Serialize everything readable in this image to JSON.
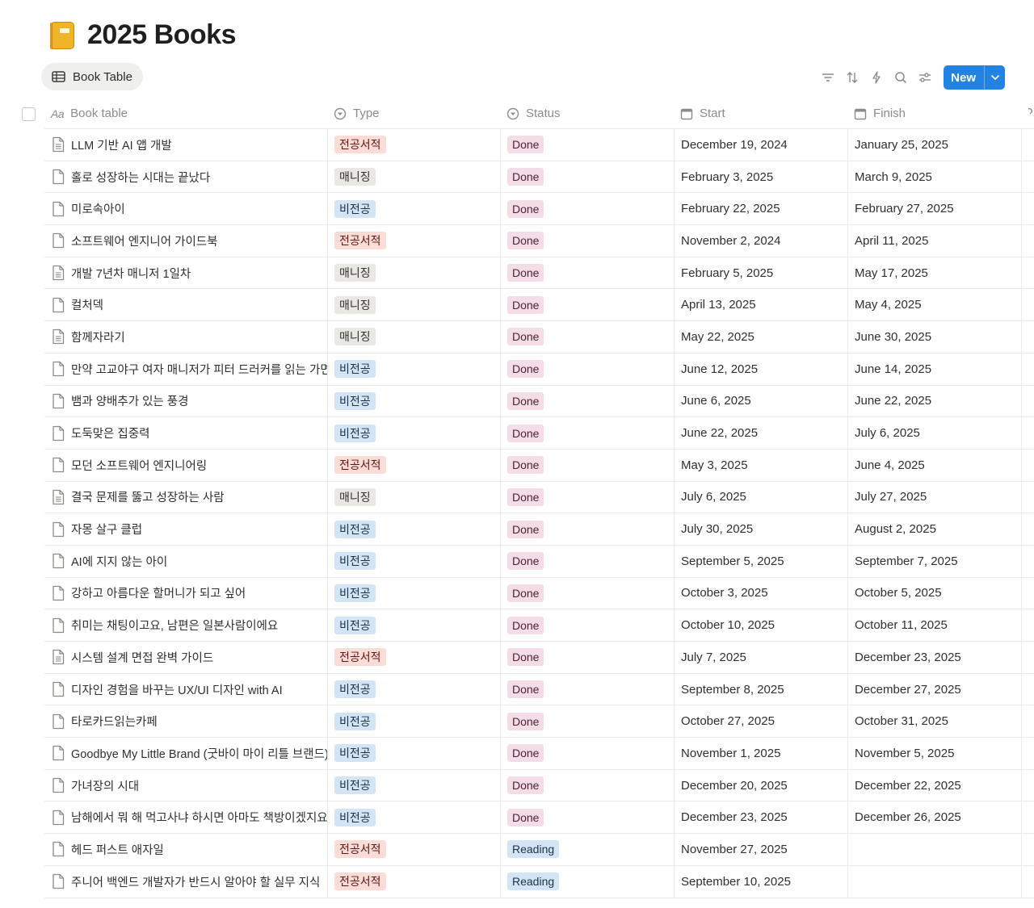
{
  "page": {
    "title": "2025 Books",
    "emoji": "ledger-book-icon"
  },
  "view": {
    "tab_label": "Book Table"
  },
  "toolbar": {
    "new_label": "New"
  },
  "columns": {
    "name": "Book table",
    "type": "Type",
    "status": "Status",
    "start": "Start",
    "finish": "Finish"
  },
  "colors": {
    "전공서적": {
      "bg": "#fbdcd6",
      "fg": "#5d1715"
    },
    "매니징": {
      "bg": "#e9e8e5",
      "fg": "#32302c"
    },
    "비전공": {
      "bg": "#d3e5f5",
      "fg": "#183347"
    },
    "Done": {
      "bg": "#f5dde8",
      "fg": "#4c2337"
    },
    "Reading": {
      "bg": "#d3e5f5",
      "fg": "#183347"
    },
    "accent": "#2383e2"
  },
  "rows": [
    {
      "name": "LLM 기반 AI 앱 개발",
      "type": "전공서적",
      "status": "Done",
      "start": "December 19, 2024",
      "finish": "January 25, 2025",
      "icon": "document-lines-icon"
    },
    {
      "name": "홀로 성장하는 시대는 끝났다",
      "type": "매니징",
      "status": "Done",
      "start": "February 3, 2025",
      "finish": "March 9, 2025",
      "icon": "document-icon"
    },
    {
      "name": "미로속아이",
      "type": "비전공",
      "status": "Done",
      "start": "February 22, 2025",
      "finish": "February 27, 2025",
      "icon": "document-icon"
    },
    {
      "name": "소프트웨어 엔지니어 가이드북",
      "type": "전공서적",
      "status": "Done",
      "start": "November 2, 2024",
      "finish": "April 11, 2025",
      "icon": "document-icon"
    },
    {
      "name": "개발 7년차 매니저 1일차",
      "type": "매니징",
      "status": "Done",
      "start": "February 5, 2025",
      "finish": "May 17, 2025",
      "icon": "document-lines-icon"
    },
    {
      "name": "컬처덱",
      "type": "매니징",
      "status": "Done",
      "start": "April 13, 2025",
      "finish": "May 4, 2025",
      "icon": "document-icon"
    },
    {
      "name": "함께자라기",
      "type": "매니징",
      "status": "Done",
      "start": "May 22, 2025",
      "finish": "June 30, 2025",
      "icon": "document-lines-icon"
    },
    {
      "name": "만약 고교야구 여자 매니저가 피터 드러커를 읽는 가면",
      "type": "비전공",
      "status": "Done",
      "start": "June 12, 2025",
      "finish": "June 14, 2025",
      "icon": "document-icon"
    },
    {
      "name": "뱀과 양배추가 있는 풍경",
      "type": "비전공",
      "status": "Done",
      "start": "June 6, 2025",
      "finish": "June 22, 2025",
      "icon": "document-icon"
    },
    {
      "name": "도둑맞은 집중력",
      "type": "비전공",
      "status": "Done",
      "start": "June 22, 2025",
      "finish": "July 6, 2025",
      "icon": "document-icon"
    },
    {
      "name": "모던 소프트웨어 엔지니어링",
      "type": "전공서적",
      "status": "Done",
      "start": "May 3, 2025",
      "finish": "June 4, 2025",
      "icon": "document-icon"
    },
    {
      "name": "결국 문제를 뚫고 성장하는 사람",
      "type": "매니징",
      "status": "Done",
      "start": "July 6, 2025",
      "finish": "July 27, 2025",
      "icon": "document-lines-icon"
    },
    {
      "name": "자몽 살구 클럽",
      "type": "비전공",
      "status": "Done",
      "start": "July 30, 2025",
      "finish": "August 2, 2025",
      "icon": "document-icon"
    },
    {
      "name": "AI에 지지 않는 아이",
      "type": "비전공",
      "status": "Done",
      "start": "September 5, 2025",
      "finish": "September 7, 2025",
      "icon": "document-icon"
    },
    {
      "name": "강하고 아름다운 할머니가 되고 싶어",
      "type": "비전공",
      "status": "Done",
      "start": "October 3, 2025",
      "finish": "October 5, 2025",
      "icon": "document-icon"
    },
    {
      "name": "취미는 채팅이고요, 남편은 일본사람이에요",
      "type": "비전공",
      "status": "Done",
      "start": "October 10, 2025",
      "finish": "October 11, 2025",
      "icon": "document-icon"
    },
    {
      "name": "시스템 설계 면접 완벽 가이드",
      "type": "전공서적",
      "status": "Done",
      "start": "July 7, 2025",
      "finish": "December 23, 2025",
      "icon": "document-lines-icon"
    },
    {
      "name": "디자인 경험을 바꾸는 UX/UI 디자인 with AI",
      "type": "비전공",
      "status": "Done",
      "start": "September 8, 2025",
      "finish": "December 27, 2025",
      "icon": "document-icon"
    },
    {
      "name": "타로카드읽는카페",
      "type": "비전공",
      "status": "Done",
      "start": "October 27, 2025",
      "finish": "October 31, 2025",
      "icon": "document-icon"
    },
    {
      "name": "Goodbye My Little Brand (굿바이 마이 리틀 브랜드)",
      "type": "비전공",
      "status": "Done",
      "start": "November 1, 2025",
      "finish": "November 5, 2025",
      "icon": "document-icon"
    },
    {
      "name": "가녀장의 시대",
      "type": "비전공",
      "status": "Done",
      "start": "December 20, 2025",
      "finish": "December 22, 2025",
      "icon": "document-icon"
    },
    {
      "name": "남해에서 뭐 해 먹고사냐 하시면 아마도 책방이겠지요",
      "type": "비전공",
      "status": "Done",
      "start": "December 23, 2025",
      "finish": "December 26, 2025",
      "icon": "document-icon"
    },
    {
      "name": "헤드 퍼스트 애자일",
      "type": "전공서적",
      "status": "Reading",
      "start": "November 27, 2025",
      "finish": "",
      "icon": "document-icon"
    },
    {
      "name": "주니어 백엔드 개발자가 반드시 알아야 할 실무 지식",
      "type": "전공서적",
      "status": "Reading",
      "start": "September 10, 2025",
      "finish": "",
      "icon": "document-icon"
    }
  ]
}
